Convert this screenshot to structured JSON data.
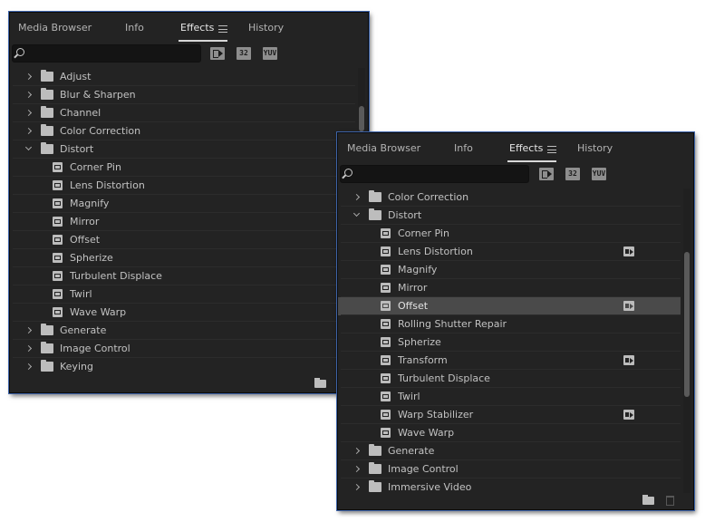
{
  "panels": [
    {
      "tabs": [
        {
          "label": "Media Browser"
        },
        {
          "label": "Info"
        },
        {
          "label": "Effects"
        },
        {
          "label": "History"
        }
      ],
      "active_tab": "Effects",
      "search": {
        "value": "",
        "placeholder": ""
      },
      "toolbar": [
        "accelerated-effects-icon",
        "32-bit-icon",
        "yuv-icon"
      ],
      "toolbar_text": {
        "b32": "32",
        "yuv": "YUV"
      },
      "items": [
        {
          "label": "Adjust",
          "kind": "folder",
          "expanded": false
        },
        {
          "label": "Blur & Sharpen",
          "kind": "folder",
          "expanded": false
        },
        {
          "label": "Channel",
          "kind": "folder",
          "expanded": false
        },
        {
          "label": "Color Correction",
          "kind": "folder",
          "expanded": false
        },
        {
          "label": "Distort",
          "kind": "folder",
          "expanded": true
        },
        {
          "label": "Corner Pin",
          "kind": "effect"
        },
        {
          "label": "Lens Distortion",
          "kind": "effect"
        },
        {
          "label": "Magnify",
          "kind": "effect"
        },
        {
          "label": "Mirror",
          "kind": "effect"
        },
        {
          "label": "Offset",
          "kind": "effect"
        },
        {
          "label": "Spherize",
          "kind": "effect"
        },
        {
          "label": "Turbulent Displace",
          "kind": "effect"
        },
        {
          "label": "Twirl",
          "kind": "effect"
        },
        {
          "label": "Wave Warp",
          "kind": "effect"
        },
        {
          "label": "Generate",
          "kind": "folder",
          "expanded": false
        },
        {
          "label": "Image Control",
          "kind": "folder",
          "expanded": false
        },
        {
          "label": "Keying",
          "kind": "folder",
          "expanded": false
        }
      ],
      "scroll_position": 0.25
    },
    {
      "tabs": [
        {
          "label": "Media Browser"
        },
        {
          "label": "Info"
        },
        {
          "label": "Effects"
        },
        {
          "label": "History"
        }
      ],
      "active_tab": "Effects",
      "search": {
        "value": "",
        "placeholder": ""
      },
      "toolbar": [
        "accelerated-effects-icon",
        "32-bit-icon",
        "yuv-icon"
      ],
      "toolbar_text": {
        "b32": "32",
        "yuv": "YUV"
      },
      "items": [
        {
          "label": "Color Correction",
          "kind": "folder",
          "expanded": false
        },
        {
          "label": "Distort",
          "kind": "folder",
          "expanded": true
        },
        {
          "label": "Corner Pin",
          "kind": "effect"
        },
        {
          "label": "Lens Distortion",
          "kind": "effect",
          "accelerated": true
        },
        {
          "label": "Magnify",
          "kind": "effect"
        },
        {
          "label": "Mirror",
          "kind": "effect"
        },
        {
          "label": "Offset",
          "kind": "effect",
          "accelerated": true,
          "selected": true
        },
        {
          "label": "Rolling Shutter Repair",
          "kind": "effect"
        },
        {
          "label": "Spherize",
          "kind": "effect"
        },
        {
          "label": "Transform",
          "kind": "effect",
          "accelerated": true
        },
        {
          "label": "Turbulent Displace",
          "kind": "effect"
        },
        {
          "label": "Twirl",
          "kind": "effect"
        },
        {
          "label": "Warp Stabilizer",
          "kind": "effect",
          "accelerated": true
        },
        {
          "label": "Wave Warp",
          "kind": "effect"
        },
        {
          "label": "Generate",
          "kind": "folder",
          "expanded": false
        },
        {
          "label": "Image Control",
          "kind": "folder",
          "expanded": false
        },
        {
          "label": "Immersive Video",
          "kind": "folder",
          "expanded": false
        }
      ],
      "scroll_position": 0.5
    }
  ],
  "colors": {
    "panel_bg": "#232323",
    "selected_row": "#4a4a4a",
    "panel_outline": "#3d63a8"
  }
}
